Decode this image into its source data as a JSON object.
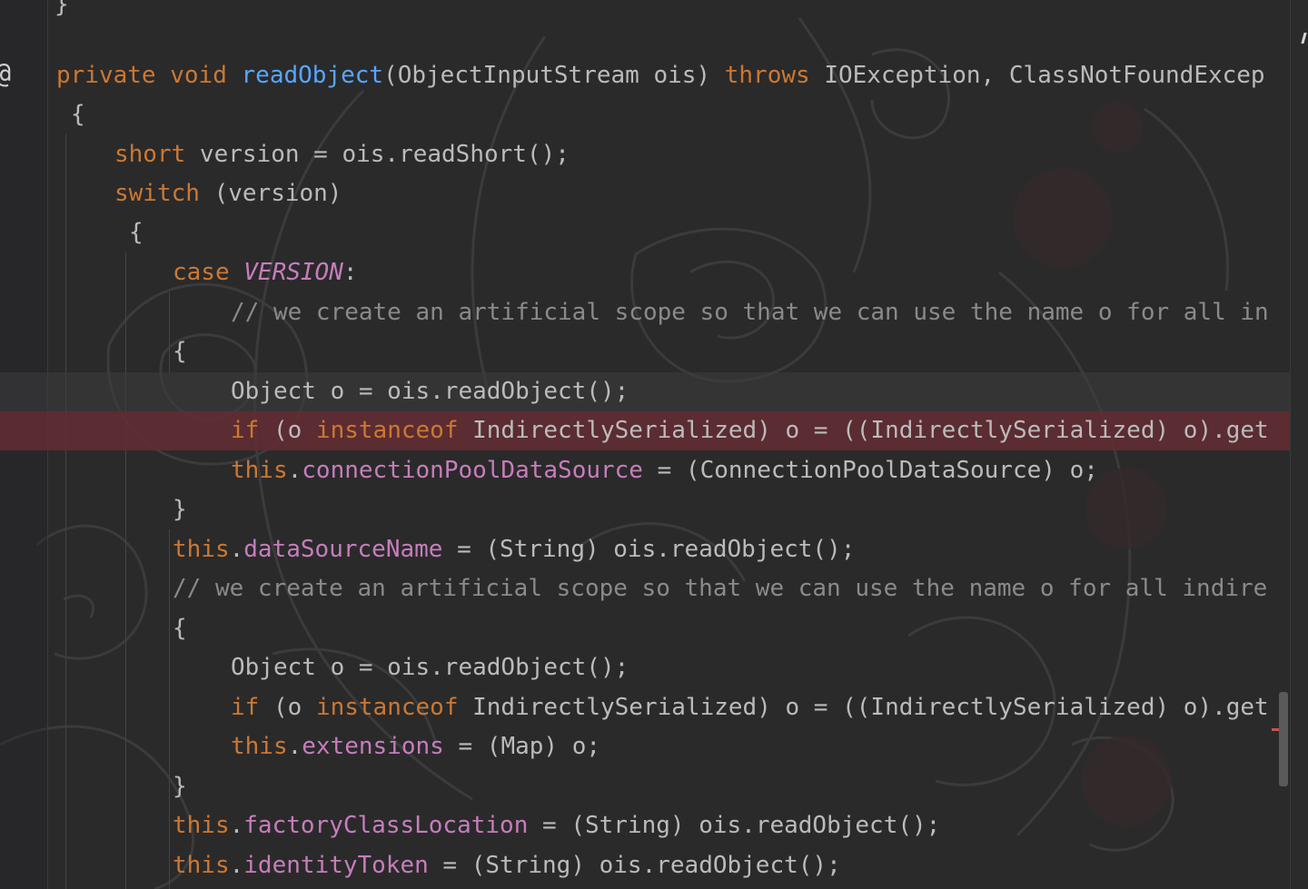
{
  "editor": {
    "gutter_annotation": "@",
    "top_fragment": "}",
    "lines": [
      {
        "tokens": [
          [
            "kw",
            "private "
          ],
          [
            "kw",
            "void "
          ],
          [
            "fn",
            "readObject"
          ],
          [
            "plain",
            "(ObjectInputStream ois) "
          ],
          [
            "kw",
            "throws "
          ],
          [
            "plain",
            "IOException, ClassNotFoundExcep"
          ]
        ]
      },
      {
        "tokens": [
          [
            "plain",
            "{"
          ]
        ]
      },
      {
        "tokens": [
          [
            "kw",
            "short "
          ],
          [
            "plain",
            "version = ois.readShort();"
          ]
        ]
      },
      {
        "tokens": [
          [
            "kw",
            "switch "
          ],
          [
            "plain",
            "(version)"
          ]
        ]
      },
      {
        "tokens": [
          [
            "plain",
            "{"
          ]
        ]
      },
      {
        "tokens": [
          [
            "kw",
            "case "
          ],
          [
            "const",
            "VERSION"
          ],
          [
            "plain",
            ":"
          ]
        ]
      },
      {
        "tokens": [
          [
            "cmt",
            "// we create an artificial scope so that we can use the name o for all in"
          ]
        ]
      },
      {
        "tokens": [
          [
            "plain",
            "{"
          ]
        ]
      },
      {
        "tokens": [
          [
            "plain",
            "Object o = ois.readObject();"
          ]
        ]
      },
      {
        "tokens": [
          [
            "kw",
            "if "
          ],
          [
            "plain",
            "(o "
          ],
          [
            "kw",
            "instanceof "
          ],
          [
            "plain",
            "IndirectlySerialized) o = ((IndirectlySerialized) o).get"
          ]
        ]
      },
      {
        "tokens": [
          [
            "kw",
            "this"
          ],
          [
            "plain",
            "."
          ],
          [
            "fld",
            "connectionPoolDataSource"
          ],
          [
            "plain",
            " = (ConnectionPoolDataSource) o;"
          ]
        ]
      },
      {
        "tokens": [
          [
            "plain",
            "}"
          ]
        ]
      },
      {
        "tokens": [
          [
            "kw",
            "this"
          ],
          [
            "plain",
            "."
          ],
          [
            "fld",
            "dataSourceName"
          ],
          [
            "plain",
            " = (String) ois.readObject();"
          ]
        ]
      },
      {
        "tokens": [
          [
            "cmt",
            "// we create an artificial scope so that we can use the name o for all indire"
          ]
        ]
      },
      {
        "tokens": [
          [
            "plain",
            "{"
          ]
        ]
      },
      {
        "tokens": [
          [
            "plain",
            "Object o = ois.readObject();"
          ]
        ]
      },
      {
        "tokens": [
          [
            "kw",
            "if "
          ],
          [
            "plain",
            "(o "
          ],
          [
            "kw",
            "instanceof "
          ],
          [
            "plain",
            "IndirectlySerialized) o = ((IndirectlySerialized) o).get"
          ]
        ]
      },
      {
        "tokens": [
          [
            "kw",
            "this"
          ],
          [
            "plain",
            "."
          ],
          [
            "fld",
            "extensions"
          ],
          [
            "plain",
            " = (Map) o;"
          ]
        ]
      },
      {
        "tokens": [
          [
            "plain",
            "}"
          ]
        ]
      },
      {
        "tokens": [
          [
            "kw",
            "this"
          ],
          [
            "plain",
            "."
          ],
          [
            "fld",
            "factoryClassLocation"
          ],
          [
            "plain",
            " = (String) ois.readObject();"
          ]
        ]
      },
      {
        "tokens": [
          [
            "kw",
            "this"
          ],
          [
            "plain",
            "."
          ],
          [
            "fld",
            "identityToken"
          ],
          [
            "plain",
            " = (String) ois.readObject();"
          ]
        ]
      }
    ]
  },
  "colors": {
    "keyword": "#cc7832",
    "method": "#57a6ff",
    "field": "#c77dbb",
    "comment": "#8a8a8a",
    "text": "#bbbbbb",
    "breakpoint_line": "#642d32"
  }
}
